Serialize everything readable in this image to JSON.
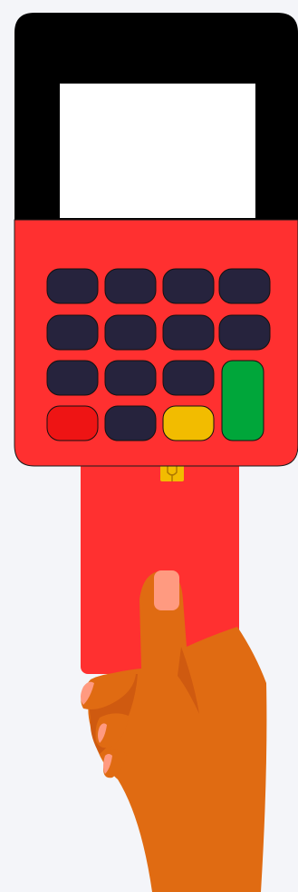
{
  "scene": {
    "background_color": "#f4f5f9",
    "description_icon": "card-payment-terminal-illustration"
  },
  "terminal": {
    "body_top_color": "#000000",
    "body_bottom_color": "#ff3030",
    "screen_color": "#ffffff",
    "screen_text": "",
    "keypad": {
      "key_color": "#26233d",
      "cancel_key_color": "#ee1414",
      "clear_key_color": "#f2bc00",
      "enter_key_color": "#00a63a",
      "key_count": 15
    }
  },
  "card": {
    "color": "#ff3030",
    "chip_color": "#f2bc00"
  },
  "hand": {
    "skin_color": "#e06b12",
    "shadow_color": "#cf5a10",
    "nail_color": "#ff9a80"
  }
}
